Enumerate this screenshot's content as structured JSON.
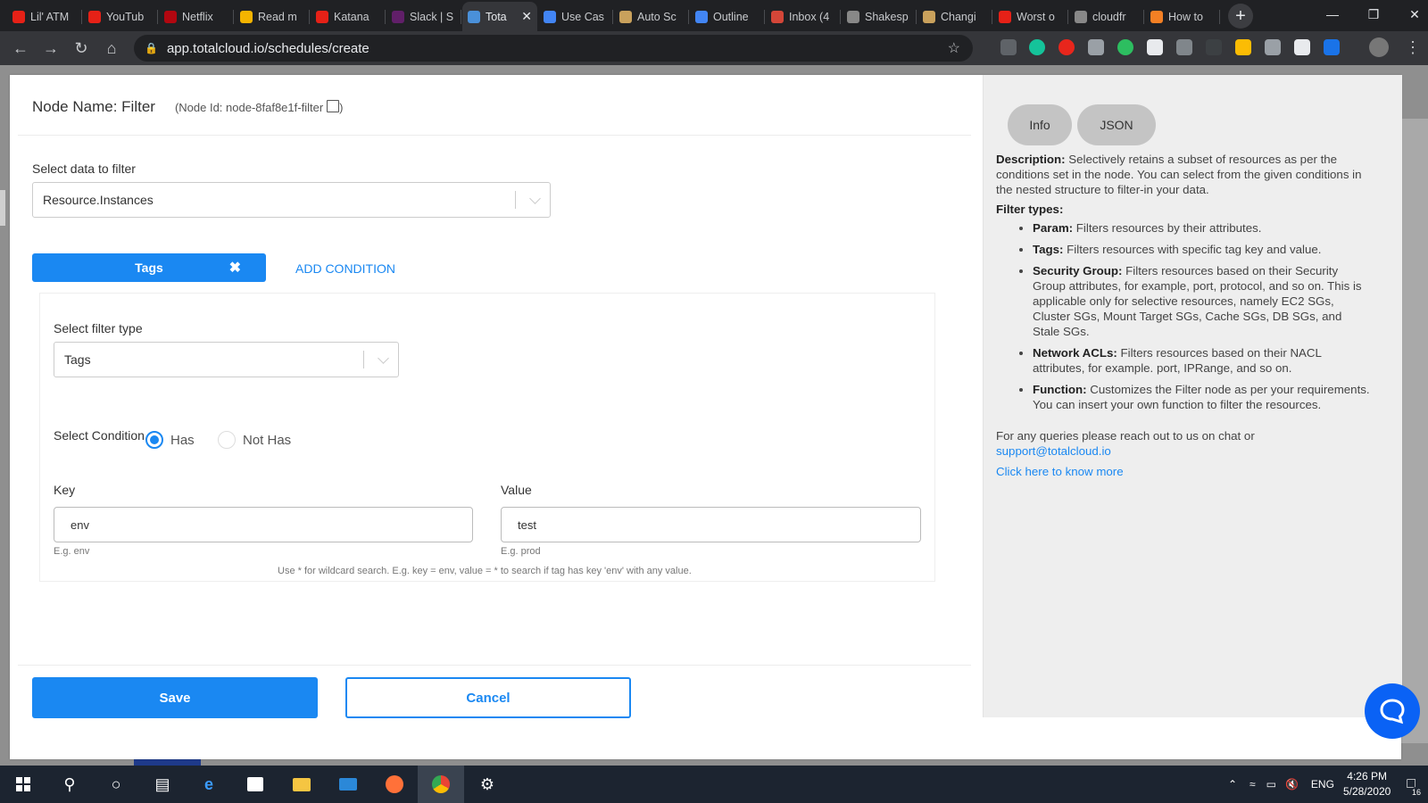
{
  "browser": {
    "tabs": [
      {
        "title": "Lil' ATM",
        "color": "#e62117"
      },
      {
        "title": "YouTub",
        "color": "#e62117"
      },
      {
        "title": "Netflix",
        "color": "#b20710"
      },
      {
        "title": "Read m",
        "color": "#f4b400"
      },
      {
        "title": "Katana",
        "color": "#e62117"
      },
      {
        "title": "Slack | S",
        "color": "#611f69"
      },
      {
        "title": "Tota",
        "color": "#4a90d9",
        "active": true
      },
      {
        "title": "Use Cas",
        "color": "#4285f4"
      },
      {
        "title": "Auto Sc",
        "color": "#c9a15c"
      },
      {
        "title": "Outline",
        "color": "#4285f4"
      },
      {
        "title": "Inbox (4",
        "color": "#d44638"
      },
      {
        "title": "Shakesp",
        "color": "#888888"
      },
      {
        "title": "Changi",
        "color": "#c9a15c"
      },
      {
        "title": "Worst o",
        "color": "#e62117"
      },
      {
        "title": "cloudfr",
        "color": "#888888"
      },
      {
        "title": "How to",
        "color": "#f48024"
      }
    ],
    "url": "app.totalcloud.io/schedules/create"
  },
  "modal": {
    "node_name": "Node Name: Filter",
    "node_id": "(Node Id: node-8faf8e1f-filter",
    "node_id_close": ")",
    "select_data_label": "Select data to filter",
    "select_data_value": "Resource.Instances",
    "chip_label": "Tags",
    "add_condition": "ADD CONDITION",
    "filter_type_label": "Select filter type",
    "filter_type_value": "Tags",
    "condition_label": "Select Condition",
    "radio_has": "Has",
    "radio_not_has": "Not Has",
    "key_label": "Key",
    "key_value": "env",
    "key_hint": "E.g. env",
    "value_label": "Value",
    "value_value": "test",
    "value_hint": "E.g. prod",
    "wildcard_note": "Use * for wildcard search. E.g. key = env, value = * to search if tag has key 'env' with any value.",
    "save": "Save",
    "cancel": "Cancel"
  },
  "info_panel": {
    "tab_info": "Info",
    "tab_json": "JSON",
    "desc_label": "Description:",
    "desc_text": " Selectively retains a subset of resources as per the conditions set in the node. You can select from the given conditions in the nested structure to filter-in your data.",
    "filter_types_label": "Filter types:",
    "items": [
      {
        "name": "Param:",
        "text": " Filters resources by their attributes."
      },
      {
        "name": "Tags:",
        "text": " Filters resources with specific tag key and value."
      },
      {
        "name": "Security Group:",
        "text": " Filters resources based on their Security Group attributes, for example, port, protocol, and so on. This is applicable only for selective resources, namely EC2 SGs, Cluster SGs, Mount Target SGs, Cache SGs, DB SGs, and Stale SGs."
      },
      {
        "name": "Network ACLs:",
        "text": " Filters resources based on their NACL attributes, for example. port, IPRange, and so on."
      },
      {
        "name": "Function:",
        "text": " Customizes the Filter node as per your requirements. You can insert your own function to filter the resources."
      }
    ],
    "queries_text": "For any queries please reach out to us on chat or",
    "support_email": "support@totalcloud.io",
    "know_more": "Click here to know more"
  },
  "taskbar": {
    "lang": "ENG",
    "time": "4:26 PM",
    "date": "5/28/2020",
    "notifications": "16"
  }
}
